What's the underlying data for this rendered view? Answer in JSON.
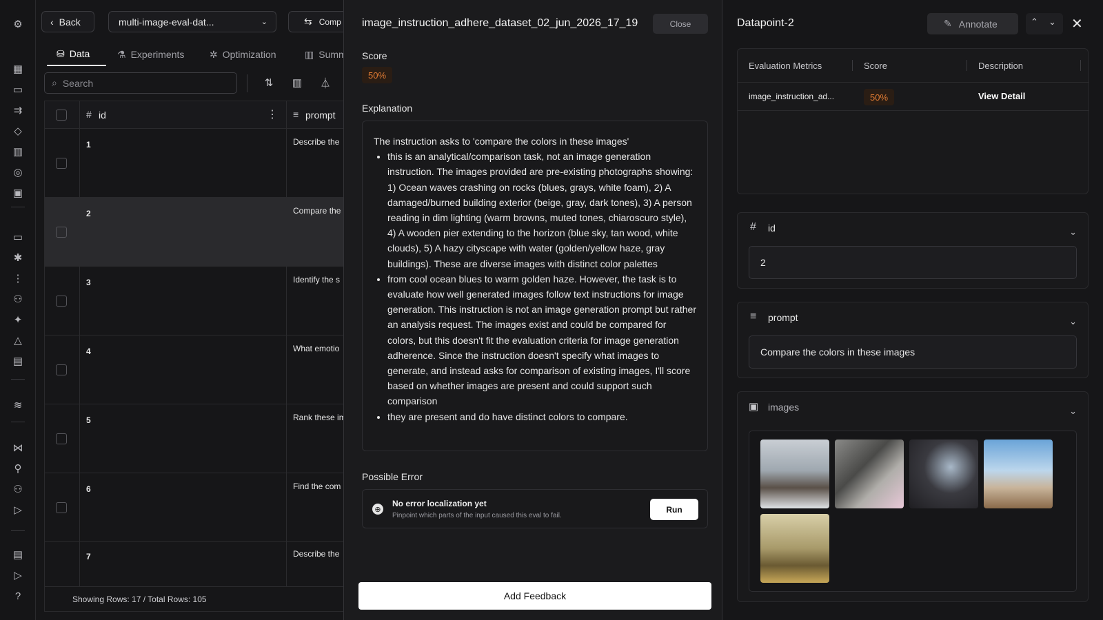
{
  "nav": {
    "back_label": "Back",
    "dataset_select": "multi-image-eval-dat...",
    "compare_label": "Comp",
    "tabs": [
      "Data",
      "Experiments",
      "Optimization",
      "Summ"
    ]
  },
  "search": {
    "placeholder": "Search"
  },
  "grid": {
    "columns": [
      "id",
      "prompt"
    ],
    "rows": [
      {
        "id": "1",
        "prompt": "Describe the"
      },
      {
        "id": "2",
        "prompt": "Compare the"
      },
      {
        "id": "3",
        "prompt": "Identify the s"
      },
      {
        "id": "4",
        "prompt": "What emotio"
      },
      {
        "id": "5",
        "prompt": "Rank these im"
      },
      {
        "id": "6",
        "prompt": "Find the com"
      },
      {
        "id": "7",
        "prompt": "Describe the"
      }
    ],
    "footer": "Showing Rows: 17 / Total Rows: 105"
  },
  "detail": {
    "title": "image_instruction_adhere_dataset_02_jun_2026_17_19",
    "close_label": "Close",
    "score_label": "Score",
    "score_value": "50%",
    "explanation_label": "Explanation",
    "explanation_intro": "The instruction asks to 'compare the colors in these images'",
    "explanation_points": [
      "this is an analytical/comparison task, not an image generation instruction. The images provided are pre-existing photographs showing: 1) Ocean waves crashing on rocks (blues, grays, white foam), 2) A damaged/burned building exterior (beige, gray, dark tones), 3) A person reading in dim lighting (warm browns, muted tones, chiaroscuro style), 4) A wooden pier extending to the horizon (blue sky, tan wood, white clouds), 5) A hazy cityscape with water (golden/yellow haze, gray buildings). These are diverse images with distinct color palettes",
      "from cool ocean blues to warm golden haze. However, the task is to evaluate how well generated images follow text instructions for image generation. This instruction is not an image generation prompt but rather an analysis request. The images exist and could be compared for colors, but this doesn't fit the evaluation criteria for image generation adherence. Since the instruction doesn't specify what images to generate, and instead asks for comparison of existing images, I'll score based on whether images are present and could support such comparison",
      "they are present and do have distinct colors to compare."
    ],
    "possible_error_label": "Possible Error",
    "error_title": "No error localization yet",
    "error_sub": "Pinpoint which parts of the input caused this eval to fail.",
    "run_label": "Run",
    "feedback_label": "Add Feedback"
  },
  "datapoint": {
    "title": "Datapoint-2",
    "annotate_label": "Annotate",
    "metrics_headers": [
      "Evaluation Metrics",
      "Score",
      "Description"
    ],
    "metric_name": "image_instruction_ad...",
    "metric_score": "50%",
    "metric_link": "View Detail",
    "id_label": "id",
    "id_value": "2",
    "prompt_label": "prompt",
    "prompt_value": "Compare the colors in these images",
    "images_label": "images"
  },
  "colors": {
    "accent_orange": "#e07b33",
    "bg": "#161618",
    "panel": "#1b1b1d"
  }
}
